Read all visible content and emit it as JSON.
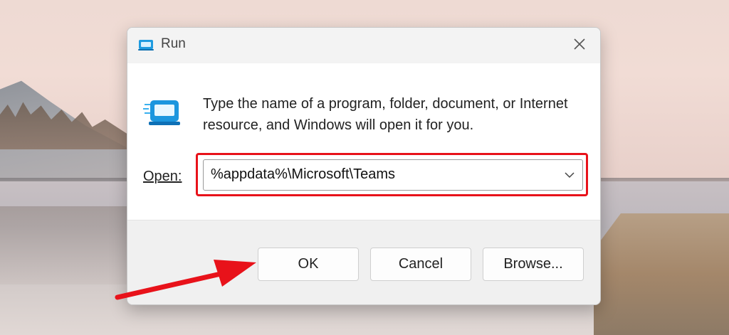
{
  "dialog": {
    "title": "Run",
    "description": "Type the name of a program, folder, document, or Internet resource, and Windows will open it for you.",
    "open_label": "Open:",
    "open_value": "%appdata%\\Microsoft\\Teams",
    "buttons": {
      "ok": "OK",
      "cancel": "Cancel",
      "browse": "Browse..."
    }
  },
  "icons": {
    "title": "run-icon",
    "close": "close-icon",
    "big": "run-app-icon",
    "dropdown": "chevron-down-icon",
    "annotation": "red-arrow"
  },
  "colors": {
    "highlight": "#e8121a",
    "arrow": "#e8121a",
    "titlebar": "#f3f3f3",
    "footer": "#f0f0f0"
  }
}
